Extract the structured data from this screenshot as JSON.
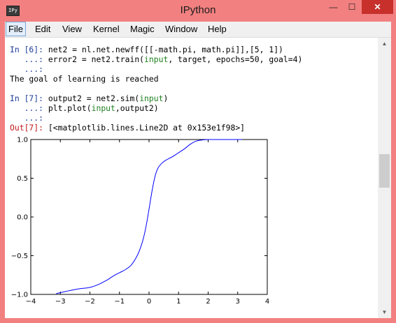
{
  "window": {
    "title": "IPython",
    "icon_label": "IPy"
  },
  "window_buttons": {
    "minimize": "—",
    "maximize": "☐",
    "close": "✕"
  },
  "menu": {
    "items": [
      {
        "label": "File"
      },
      {
        "label": "Edit"
      },
      {
        "label": "View"
      },
      {
        "label": "Kernel"
      },
      {
        "label": "Magic"
      },
      {
        "label": "Window"
      },
      {
        "label": "Help"
      }
    ]
  },
  "console": {
    "in6_prompt": "In [6]:",
    "in6_line1": "net2 = nl.net.newff([[-math.pi, math.pi]],[5, 1])",
    "cont_prompt": "...:",
    "in6_line2_pre": "error2 = net2.train(",
    "in6_line2_input": "input",
    "in6_line2_post": ", target, epochs=50, goal=4)",
    "output_text": "The goal of learning is reached",
    "in7_prompt": "In [7]:",
    "in7_line1_pre": "output2 = net2.sim(",
    "in7_line1_input": "input",
    "in7_line1_post": ")",
    "in7_line2_pre": "plt.plot(",
    "in7_line2_input": "input",
    "in7_line2_post": ",output2)",
    "out7_prompt": "Out[7]:",
    "out7_text": "[<matplotlib.lines.Line2D at 0x153e1f98>]"
  },
  "chart_data": {
    "type": "line",
    "title": "",
    "xlabel": "",
    "ylabel": "",
    "xlim": [
      -4,
      4
    ],
    "ylim": [
      -1.0,
      1.0
    ],
    "x_ticks": [
      "−4",
      "−3",
      "−2",
      "−1",
      "0",
      "1",
      "2",
      "3",
      "4"
    ],
    "y_ticks": [
      "1.0",
      "0.5",
      "0.0",
      "−0.5",
      "−1.0"
    ],
    "grid": false,
    "color": "#0000ff",
    "series": [
      {
        "x": [
          -3.14,
          -2.8,
          -2.4,
          -2.0,
          -1.7,
          -1.4,
          -1.2,
          -1.0,
          -0.8,
          -0.6,
          -0.4,
          -0.3,
          -0.2,
          -0.1,
          0.0,
          0.1,
          0.2,
          0.3,
          0.45,
          0.6,
          0.8,
          1.0,
          1.2,
          1.4,
          1.6,
          1.8,
          2.0,
          2.4,
          2.8,
          3.14
        ],
        "y": [
          -0.99,
          -0.96,
          -0.93,
          -0.91,
          -0.87,
          -0.81,
          -0.76,
          -0.72,
          -0.68,
          -0.62,
          -0.5,
          -0.41,
          -0.29,
          -0.12,
          0.1,
          0.33,
          0.52,
          0.63,
          0.7,
          0.74,
          0.78,
          0.83,
          0.88,
          0.94,
          0.98,
          0.995,
          1.0,
          1.0,
          1.0,
          1.0
        ]
      }
    ]
  }
}
